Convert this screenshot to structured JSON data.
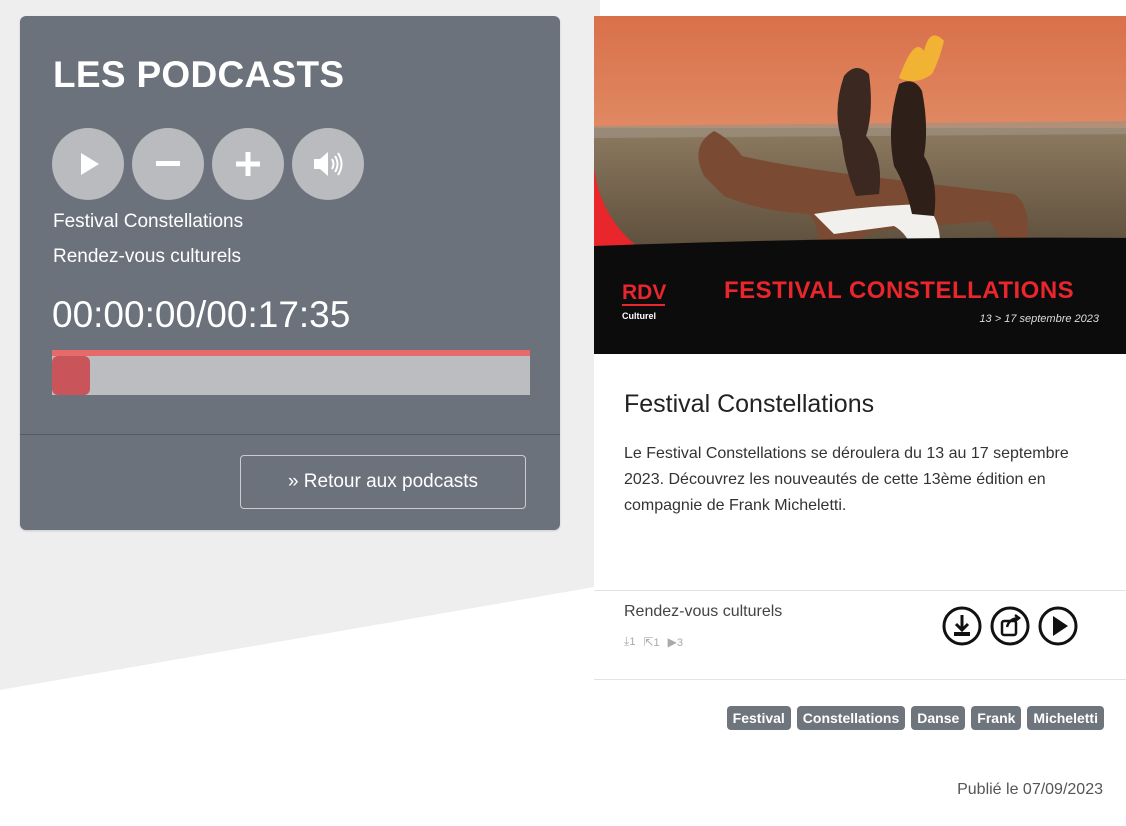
{
  "player": {
    "title": "LES PODCASTS",
    "controls": [
      {
        "name": "play-icon"
      },
      {
        "name": "volume-down-icon"
      },
      {
        "name": "volume-up-icon"
      },
      {
        "name": "speaker-icon"
      }
    ],
    "episode_title": "Festival Constellations",
    "category": "Rendez-vous culturels",
    "timer": "00:00:00/00:17:35",
    "progress": 0,
    "back_label": "» Retour aux podcasts",
    "colors": {
      "panel": "#6b727b",
      "progress_accent": "#e66a6a",
      "thumb": "#c9545a"
    }
  },
  "card": {
    "image": {
      "brand": "RDV",
      "brand_sub": "Culturel",
      "banner_title": "FESTIVAL CONSTELLATIONS",
      "banner_dates": "13 > 17 septembre 2023"
    },
    "title": "Festival Constellations",
    "description": "Le Festival Constellations se déroulera du 13 au 17 septembre 2023. Découvrez les nouveautés de cette 13ème édition en compagnie de Frank Micheletti.",
    "category": "Rendez-vous culturels",
    "stats": {
      "downloads": "1",
      "shares": "1",
      "plays": "3"
    },
    "actions": [
      "download-icon",
      "share-icon",
      "play-icon"
    ],
    "tags": [
      "Festival",
      "Constellations",
      "Danse",
      "Frank",
      "Micheletti"
    ],
    "published": "Publié le 07/09/2023",
    "colors": {
      "banner_red": "#e8262c",
      "tag_bg": "#6e757d"
    }
  }
}
